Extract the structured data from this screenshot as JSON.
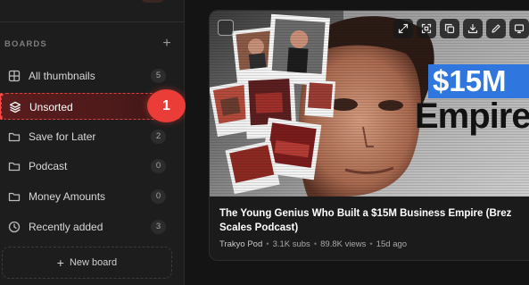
{
  "sidebar": {
    "boards_title": "BOARDS",
    "add_board_glyph": "+",
    "items": [
      {
        "label": "All thumbnails",
        "count": "5",
        "icon": "grid-icon"
      },
      {
        "label": "Unsorted",
        "count": "",
        "icon": "layers-icon",
        "selected": true
      },
      {
        "label": "Save for Later",
        "count": "2",
        "icon": "folder-icon"
      },
      {
        "label": "Podcast",
        "count": "0",
        "icon": "folder-icon"
      },
      {
        "label": "Money Amounts",
        "count": "0",
        "icon": "folder-icon"
      },
      {
        "label": "Recently added",
        "count": "3",
        "icon": "clock-icon"
      }
    ],
    "step_badge": "1",
    "new_board_label": "New board",
    "new_board_glyph": "+"
  },
  "card": {
    "thumbnail_text_line1": "$15M",
    "thumbnail_text_line2": "Empire",
    "actions": [
      "expand-icon",
      "fullscreen-icon",
      "copy-icon",
      "download-icon",
      "edit-icon",
      "screen-icon"
    ],
    "title": "The Young Genius Who Built a $15M Business Empire (Brez Scales Podcast)",
    "channel": "Trakyo Pod",
    "subs": "3.1K subs",
    "views": "89.8K views",
    "age": "15d ago"
  },
  "colors": {
    "accent": "#ea3d38",
    "selected_bg": "#551c1c",
    "sidebar_bg": "#1d1d1d",
    "overlay_blue": "#2f76de"
  }
}
